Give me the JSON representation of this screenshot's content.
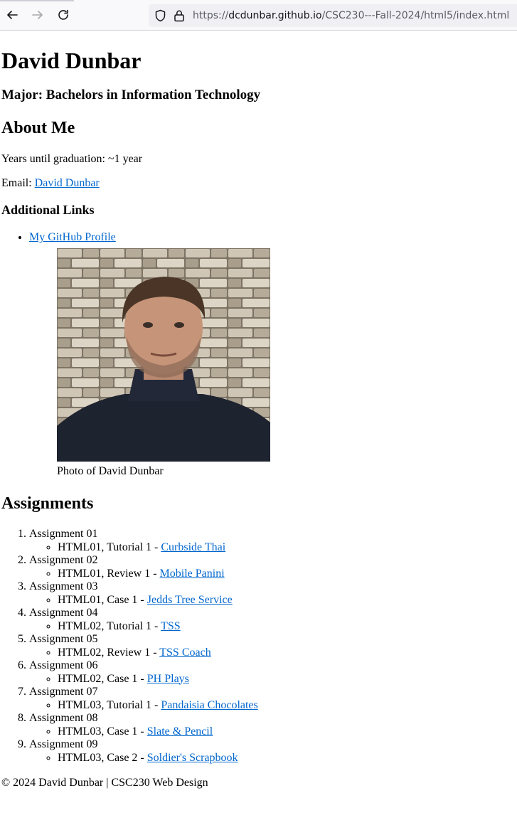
{
  "browser": {
    "url_prefix": "https://",
    "url_host": "dcdunbar.github.io",
    "url_path": "/CSC230---Fall-2024/html5/index.html"
  },
  "header": {
    "name": "David Dunbar",
    "major": "Major: Bachelors in Information Technology"
  },
  "about": {
    "heading": "About Me",
    "graduation": "Years until graduation: ~1 year",
    "email_label": "Email: ",
    "email_link": "David Dunbar"
  },
  "links": {
    "heading": "Additional Links",
    "items": [
      {
        "label": "My GitHub Profile"
      }
    ]
  },
  "photo": {
    "caption": "Photo of David Dunbar"
  },
  "assignments": {
    "heading": "Assignments",
    "items": [
      {
        "title": "Assignment 01",
        "task": "HTML01, Tutorial 1 - ",
        "link": "Curbside Thai"
      },
      {
        "title": "Assignment 02",
        "task": "HTML01, Review 1 - ",
        "link": "Mobile Panini"
      },
      {
        "title": "Assignment 03",
        "task": "HTML01, Case 1 - ",
        "link": "Jedds Tree Service"
      },
      {
        "title": "Assignment 04",
        "task": "HTML02, Tutorial 1 - ",
        "link": "TSS"
      },
      {
        "title": "Assignment 05",
        "task": "HTML02, Review 1 - ",
        "link": "TSS Coach"
      },
      {
        "title": "Assignment 06",
        "task": "HTML02, Case 1 - ",
        "link": "PH Plays"
      },
      {
        "title": "Assignment 07",
        "task": "HTML03, Tutorial 1 - ",
        "link": "Pandaisia Chocolates"
      },
      {
        "title": "Assignment 08",
        "task": "HTML03, Case 1 - ",
        "link": "Slate & Pencil"
      },
      {
        "title": "Assignment 09",
        "task": "HTML03, Case 2 - ",
        "link": "Soldier's Scrapbook"
      }
    ]
  },
  "footer": {
    "text": "© 2024 David Dunbar | CSC230 Web Design"
  }
}
